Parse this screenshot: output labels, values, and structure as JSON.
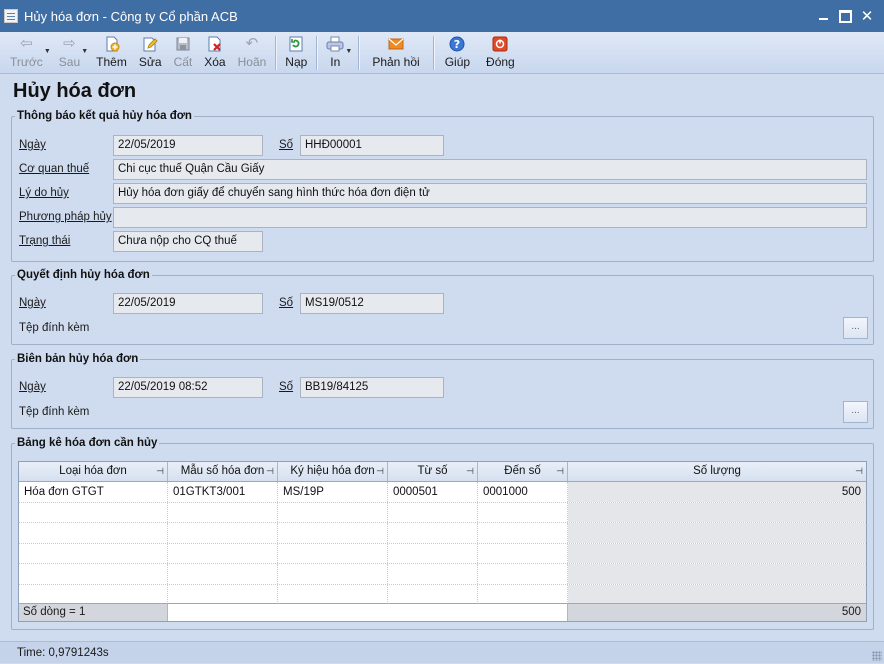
{
  "window": {
    "title": "Hủy hóa đơn - Công ty Cổ phần ACB"
  },
  "toolbar": {
    "items": [
      {
        "label": "Trước",
        "icon": "arrow-left-icon",
        "disabled": true
      },
      {
        "label": "Sau",
        "icon": "arrow-right-icon",
        "disabled": true
      },
      {
        "label": "Thêm",
        "icon": "add-document-icon",
        "disabled": false
      },
      {
        "label": "Sửa",
        "icon": "edit-icon",
        "disabled": false
      },
      {
        "label": "Cất",
        "icon": "save-icon",
        "disabled": true
      },
      {
        "label": "Xóa",
        "icon": "delete-icon",
        "disabled": false
      },
      {
        "label": "Hoãn",
        "icon": "undo-icon",
        "disabled": true
      },
      {
        "label": "Nạp",
        "icon": "refresh-icon",
        "disabled": false
      },
      {
        "label": "In",
        "icon": "printer-icon",
        "disabled": false
      },
      {
        "label": "Phản hồi",
        "icon": "feedback-mail-icon",
        "disabled": false
      },
      {
        "label": "Giúp",
        "icon": "help-icon",
        "disabled": false
      },
      {
        "label": "Đóng",
        "icon": "close-icon",
        "disabled": false
      }
    ]
  },
  "page": {
    "title": "Hủy hóa đơn"
  },
  "notice": {
    "legend": "Thông báo kết quả hủy hóa đơn",
    "date_label": "Ngày",
    "date_value": "22/05/2019",
    "number_label": "Số",
    "number_value": "HHĐ00001",
    "agency_label": "Cơ quan thuế",
    "agency_value": "Chi cục thuế Quận Cầu Giấy",
    "reason_label": "Lý do hủy",
    "reason_value": "Hủy hóa đơn giấy để chuyển sang hình thức hóa đơn điện tử",
    "method_label": "Phương pháp hủy",
    "method_value": "",
    "status_label": "Trạng thái",
    "status_value": "Chưa nộp cho CQ thuế"
  },
  "decision": {
    "legend": "Quyết định hủy hóa đơn",
    "date_label": "Ngày",
    "date_value": "22/05/2019",
    "number_label": "Số",
    "number_value": "MS19/0512",
    "attach_label": "Tệp đính kèm",
    "browse_label": "..."
  },
  "minutes": {
    "legend": "Biên bản hủy hóa đơn",
    "date_label": "Ngày",
    "date_value": "22/05/2019 08:52",
    "number_label": "Số",
    "number_value": "BB19/84125",
    "attach_label": "Tệp đính kèm",
    "browse_label": "..."
  },
  "table": {
    "legend": "Bảng kê hóa đơn cần hủy",
    "columns": [
      "Loại hóa đơn",
      "Mẫu số hóa đơn",
      "Ký hiệu hóa đơn",
      "Từ số",
      "Đến số",
      "Số lượng"
    ],
    "rows": [
      [
        "Hóa đơn GTGT",
        "01GTKT3/001",
        "MS/19P",
        "0000501",
        "0001000",
        "500"
      ]
    ],
    "footer_count": "Số dòng = 1",
    "footer_total": "500"
  },
  "status": {
    "text": "Time: 0,9791243s"
  }
}
